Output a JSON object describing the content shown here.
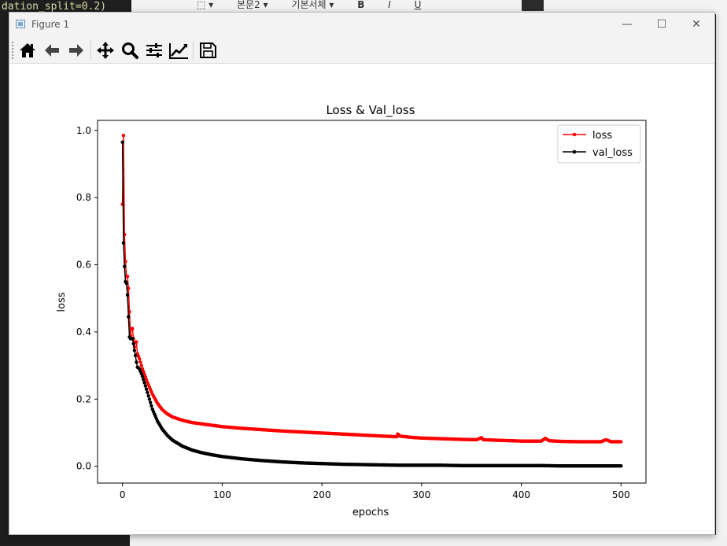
{
  "background": {
    "code_top": "dation_split=0.2)",
    "word_tools": [
      "⬚ ▾",
      "본문2 ▾",
      "기본서체 ▾",
      "B",
      "I",
      "U"
    ]
  },
  "window": {
    "title": "Figure 1",
    "minimize": "—",
    "maximize": "☐",
    "close": "✕"
  },
  "toolbar": {
    "buttons": [
      "home-icon",
      "back-arrow-icon",
      "forward-arrow-icon",
      "pan-icon",
      "zoom-icon",
      "configure-subplots-icon",
      "edit-axis-icon",
      "save-icon"
    ]
  },
  "colors": {
    "loss": "#ff0000",
    "val_loss": "#000000"
  },
  "chart_data": {
    "type": "line",
    "title": "Loss & Val_loss",
    "xlabel": "epochs",
    "ylabel": "loss",
    "xlim": [
      -25,
      525
    ],
    "ylim": [
      -0.05,
      1.03
    ],
    "xticks": [
      0,
      100,
      200,
      300,
      400,
      500
    ],
    "yticks": [
      0.0,
      0.2,
      0.4,
      0.6,
      0.8,
      1.0
    ],
    "xtick_labels": [
      "0",
      "100",
      "200",
      "300",
      "400",
      "500"
    ],
    "ytick_labels": [
      "0.0",
      "0.2",
      "0.4",
      "0.6",
      "0.8",
      "1.0"
    ],
    "grid": false,
    "legend": "top-right",
    "series": [
      {
        "name": "loss",
        "points": [
          [
            0,
            0.78
          ],
          [
            1,
            0.985
          ],
          [
            2,
            0.69
          ],
          [
            3,
            0.61
          ],
          [
            4,
            0.565
          ],
          [
            5,
            0.565
          ],
          [
            6,
            0.53
          ],
          [
            7,
            0.46
          ],
          [
            8,
            0.39
          ],
          [
            9,
            0.41
          ],
          [
            10,
            0.41
          ],
          [
            11,
            0.38
          ],
          [
            12,
            0.355
          ],
          [
            13,
            0.37
          ],
          [
            14,
            0.37
          ],
          [
            15,
            0.335
          ],
          [
            17,
            0.32
          ],
          [
            20,
            0.29
          ],
          [
            25,
            0.25
          ],
          [
            30,
            0.215
          ],
          [
            35,
            0.188
          ],
          [
            40,
            0.168
          ],
          [
            45,
            0.156
          ],
          [
            50,
            0.147
          ],
          [
            60,
            0.137
          ],
          [
            70,
            0.13
          ],
          [
            80,
            0.126
          ],
          [
            90,
            0.122
          ],
          [
            100,
            0.118
          ],
          [
            120,
            0.113
          ],
          [
            140,
            0.109
          ],
          [
            160,
            0.105
          ],
          [
            180,
            0.102
          ],
          [
            200,
            0.099
          ],
          [
            220,
            0.096
          ],
          [
            240,
            0.093
          ],
          [
            260,
            0.09
          ],
          [
            275,
            0.088
          ],
          [
            276,
            0.096
          ],
          [
            278,
            0.09
          ],
          [
            290,
            0.086
          ],
          [
            300,
            0.084
          ],
          [
            320,
            0.082
          ],
          [
            340,
            0.08
          ],
          [
            355,
            0.079
          ],
          [
            360,
            0.085
          ],
          [
            362,
            0.079
          ],
          [
            380,
            0.077
          ],
          [
            400,
            0.075
          ],
          [
            420,
            0.075
          ],
          [
            424,
            0.083
          ],
          [
            428,
            0.076
          ],
          [
            440,
            0.074
          ],
          [
            460,
            0.073
          ],
          [
            480,
            0.073
          ],
          [
            485,
            0.079
          ],
          [
            490,
            0.073
          ],
          [
            500,
            0.073
          ]
        ]
      },
      {
        "name": "val_loss",
        "points": [
          [
            0,
            0.965
          ],
          [
            1,
            0.665
          ],
          [
            2,
            0.595
          ],
          [
            3,
            0.55
          ],
          [
            4,
            0.545
          ],
          [
            5,
            0.51
          ],
          [
            6,
            0.445
          ],
          [
            7,
            0.385
          ],
          [
            8,
            0.38
          ],
          [
            9,
            0.38
          ],
          [
            10,
            0.38
          ],
          [
            11,
            0.365
          ],
          [
            12,
            0.345
          ],
          [
            13,
            0.33
          ],
          [
            14,
            0.31
          ],
          [
            15,
            0.295
          ],
          [
            17,
            0.29
          ],
          [
            20,
            0.268
          ],
          [
            25,
            0.22
          ],
          [
            30,
            0.17
          ],
          [
            35,
            0.135
          ],
          [
            40,
            0.11
          ],
          [
            45,
            0.092
          ],
          [
            50,
            0.078
          ],
          [
            60,
            0.06
          ],
          [
            70,
            0.048
          ],
          [
            80,
            0.04
          ],
          [
            90,
            0.034
          ],
          [
            100,
            0.029
          ],
          [
            120,
            0.022
          ],
          [
            140,
            0.017
          ],
          [
            160,
            0.013
          ],
          [
            180,
            0.01
          ],
          [
            200,
            0.008
          ],
          [
            220,
            0.006
          ],
          [
            240,
            0.005
          ],
          [
            260,
            0.004
          ],
          [
            280,
            0.003
          ],
          [
            300,
            0.003
          ],
          [
            320,
            0.003
          ],
          [
            340,
            0.002
          ],
          [
            360,
            0.002
          ],
          [
            380,
            0.002
          ],
          [
            400,
            0.002
          ],
          [
            420,
            0.002
          ],
          [
            440,
            0.001
          ],
          [
            460,
            0.001
          ],
          [
            480,
            0.001
          ],
          [
            500,
            0.001
          ]
        ]
      }
    ]
  }
}
